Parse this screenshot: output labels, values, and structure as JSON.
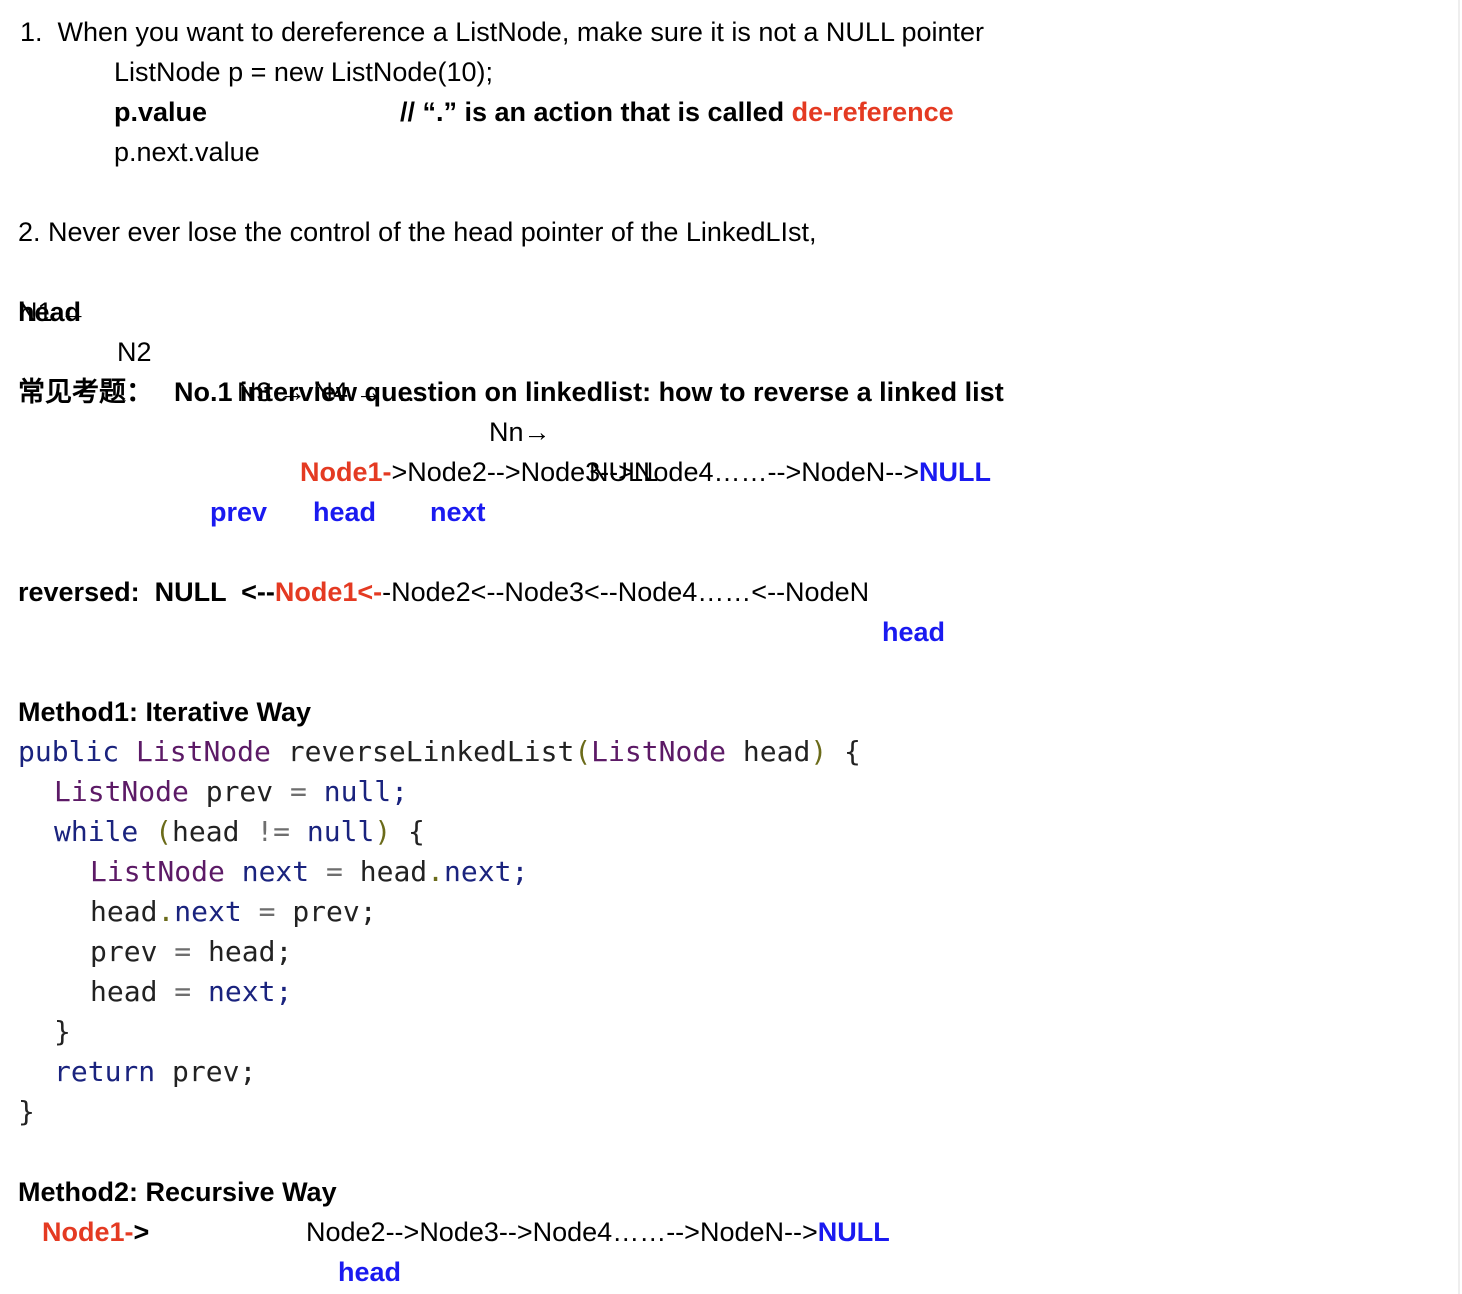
{
  "section1": {
    "line": "1.  When you want to dereference a ListNode, make sure it is not a NULL pointer",
    "code1": "ListNode p = new ListNode(10);",
    "code2": "p.value",
    "comment_prefix": "// “.” is an action that is called ",
    "comment_highlight": "de-reference",
    "code3": "p.next.value"
  },
  "section2": {
    "line": "2. Never ever lose the control of the head pointer of the LinkedLIst,",
    "n1": "N1 ←",
    "n2": "N2",
    "n3n4": "N3 → N4 →  …",
    "nn": "Nn→",
    "null": "NULL",
    "head": "head"
  },
  "question": {
    "prefix": "常见考题：",
    "text": "No.1 interview question on linkedlist: how to reverse a linked list"
  },
  "original": {
    "node1": "Node1-",
    "rest": ">Node2-->Node3-->Node4……-->NodeN-->",
    "null": "NULL",
    "prev": "prev",
    "head": "head",
    "next": "next"
  },
  "reversed": {
    "label": "reversed:  NULL  <--",
    "node1": "Node1<-",
    "rest": "-Node2<--Node3<--Node4……<--NodeN",
    "head": "head"
  },
  "method1": {
    "title": "Method1: Iterative Way",
    "tokens": {
      "public": "public",
      "listnode": "ListNode",
      "fname": "reverseLinkedList",
      "lparen": "(",
      "rparen": ")",
      "head": "head",
      "prev": "prev",
      "next": "next",
      "null": "null",
      "while": "while",
      "neq": "!=",
      "eq": "=",
      "dot": ".",
      "semi": ";",
      "lbrace": "{",
      "rbrace": "}",
      "return": "return"
    }
  },
  "method2": {
    "title": "Method2: Recursive Way",
    "node1": "Node1-",
    "arrow": ">",
    "rest": "Node2-->Node3-->Node4……-->NodeN-->",
    "null": "NULL",
    "head": "head"
  }
}
